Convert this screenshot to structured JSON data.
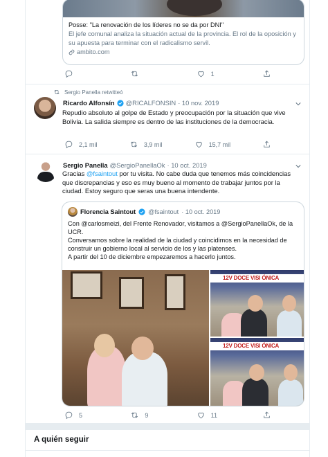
{
  "top_card": {
    "title": "Posse: \"La renovación de los líderes no se da por DNI\"",
    "description": "El jefe comunal analiza la situación actual de la provincia. El rol de la oposición y su apuesta para terminar con el radicalismo servil.",
    "domain": "ambito.com",
    "actions": {
      "reply": "",
      "retweet": "",
      "like": "1",
      "share": ""
    }
  },
  "tweet_alfonsin": {
    "retweet_label": "Sergio Panella retwitteó",
    "name": "Ricardo Alfonsín",
    "handle": "@RICALFONSIN",
    "date": "· 10 nov. 2019",
    "text": "Repudio absoluto al golpe de Estado y preocupación por la situación que vive Bolivia. La salida siempre es dentro de las instituciones de la democracia.",
    "actions": {
      "reply": "2,1 mil",
      "retweet": "3,9 mil",
      "like": "15,7 mil",
      "share": ""
    }
  },
  "tweet_panella": {
    "name": "Sergio Panella",
    "handle": "@SergioPanellaOk",
    "date": "· 10 oct. 2019",
    "text_pre": "Gracias ",
    "mention": "@fsaintout",
    "text_post": " por tu visita. No cabe duda que tenemos más coincidencias que discrepancias y eso es muy bueno al momento de trabajar juntos por la ciudad. Estoy seguro que seras una buena intendente.",
    "actions": {
      "reply": "5",
      "retweet": "9",
      "like": "11",
      "share": ""
    }
  },
  "quoted_tweet": {
    "name": "Florencia Saintout",
    "handle": "@fsaintout",
    "date": "· 10 oct. 2019",
    "text": "Con @carlosmeizi, del Frente Renovador, visitamos a @SergioPanellaOk, de la UCR.\nConversamos sobre la realidad de la ciudad y coincidimos en la necesidad de construir un gobierno local al servicio de los y las platenses.\nA partir del 10 de diciembre empezaremos a hacerlo juntos.",
    "photo_banner": "12V DOCE VISI  ÓNICA"
  },
  "sidebar": {
    "who_to_follow": "A quién seguir"
  },
  "colors": {
    "accent": "#1da1f2",
    "muted": "#657786",
    "border": "#e6ecf0"
  },
  "icons": [
    "reply-icon",
    "retweet-icon",
    "like-icon",
    "share-icon",
    "verified-icon",
    "chevron-down-icon",
    "link-icon"
  ]
}
